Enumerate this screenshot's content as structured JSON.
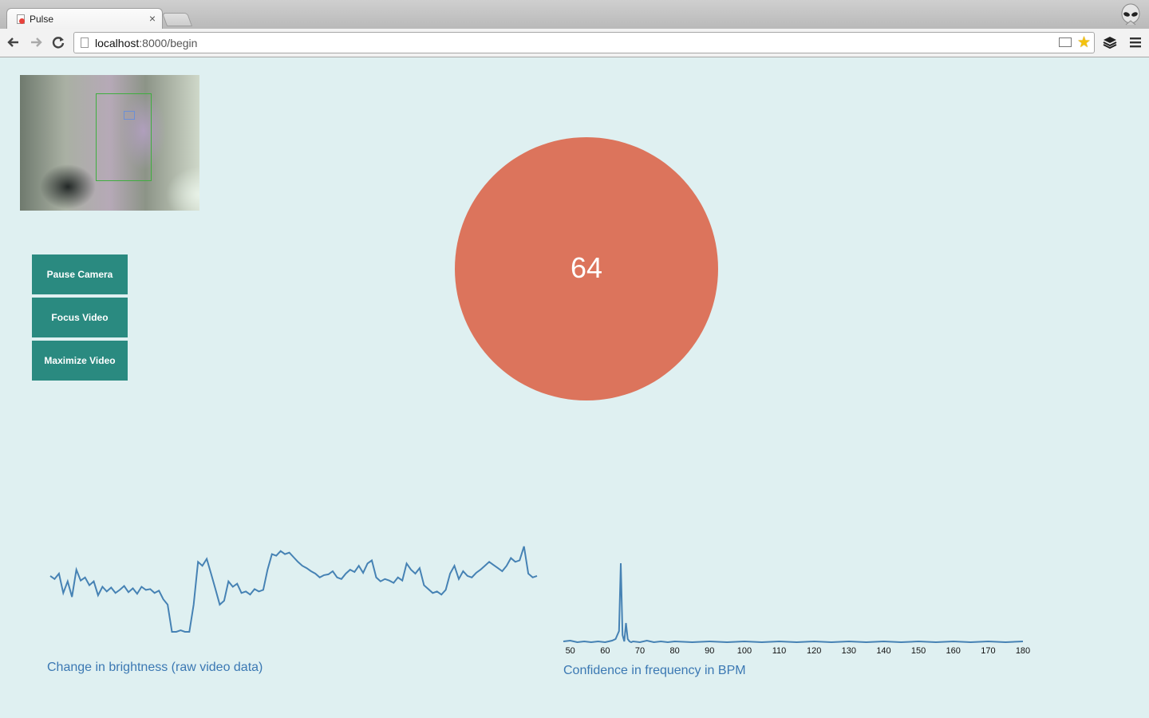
{
  "browser": {
    "tab_title": "Pulse",
    "tab_close": "×",
    "url_host": "localhost",
    "url_path": ":8000/begin",
    "back_icon": "back-arrow-icon",
    "forward_icon": "forward-arrow-icon",
    "reload_icon": "reload-icon",
    "star_icon": "bookmark-star-icon",
    "menu_icon": "menu-icon",
    "extension_icon": "layers-icon",
    "profile_icon": "alien-avatar-icon"
  },
  "controls": {
    "pause_camera": "Pause Camera",
    "focus_video": "Focus Video",
    "maximize_video": "Maximize Video"
  },
  "colors": {
    "page_bg": "#dff0f1",
    "button_bg": "#2a8a80",
    "bpm_circle": "#dc745c",
    "line": "#4682b4"
  },
  "bpm": {
    "value": "64"
  },
  "raw_chart": {
    "caption": "Change in brightness (raw video data)"
  },
  "fft_chart": {
    "caption": "Confidence in frequency in BPM"
  },
  "chart_data": [
    {
      "type": "line",
      "title": "Change in brightness (raw video data)",
      "x": [
        0,
        1,
        2,
        3,
        4,
        5,
        6,
        7,
        8,
        9,
        10,
        11,
        12,
        13,
        14,
        15,
        16,
        17,
        18,
        19,
        20,
        21,
        22,
        23,
        24,
        25,
        26,
        27,
        28,
        29,
        30,
        31,
        32,
        33,
        34,
        35,
        36,
        37,
        38,
        39,
        40,
        41,
        42,
        43,
        44,
        45,
        46,
        47,
        48,
        49,
        50,
        51,
        52,
        53,
        54,
        55,
        56,
        57,
        58,
        59,
        60,
        61,
        62,
        63,
        64,
        65,
        66,
        67,
        68,
        69,
        70,
        71,
        72,
        73,
        74,
        75,
        76,
        77,
        78,
        79,
        80,
        81,
        82,
        83,
        84,
        85,
        86,
        87,
        88,
        89,
        90,
        91,
        92,
        93,
        94,
        95,
        96,
        97,
        98,
        99,
        100,
        101,
        102,
        103,
        104,
        105,
        106,
        107,
        108,
        109,
        110,
        111,
        112,
        113,
        114,
        115,
        116,
        117,
        118,
        119
      ],
      "values": [
        0.42,
        0.38,
        0.45,
        0.2,
        0.35,
        0.15,
        0.5,
        0.36,
        0.4,
        0.3,
        0.35,
        0.17,
        0.28,
        0.22,
        0.27,
        0.2,
        0.24,
        0.29,
        0.21,
        0.26,
        0.19,
        0.28,
        0.24,
        0.25,
        0.2,
        0.23,
        0.12,
        0.05,
        -0.3,
        -0.4,
        -0.28,
        -0.32,
        -0.4,
        0.05,
        0.6,
        0.55,
        0.64,
        0.45,
        0.25,
        0.05,
        0.1,
        0.35,
        0.28,
        0.32,
        0.2,
        0.22,
        0.18,
        0.25,
        0.22,
        0.24,
        0.5,
        0.7,
        0.68,
        0.74,
        0.7,
        0.72,
        0.66,
        0.6,
        0.55,
        0.52,
        0.48,
        0.45,
        0.4,
        0.43,
        0.44,
        0.48,
        0.4,
        0.38,
        0.45,
        0.5,
        0.47,
        0.55,
        0.46,
        0.58,
        0.62,
        0.4,
        0.35,
        0.38,
        0.36,
        0.33,
        0.4,
        0.36,
        0.58,
        0.5,
        0.45,
        0.52,
        0.3,
        0.25,
        0.2,
        0.22,
        0.18,
        0.24,
        0.45,
        0.55,
        0.38,
        0.48,
        0.42,
        0.4,
        0.46,
        0.5,
        0.55,
        0.6,
        0.56,
        0.52,
        0.48,
        0.55,
        0.65,
        0.6,
        0.62,
        0.8,
        0.45,
        0.4,
        0.42
      ],
      "xlabel": "",
      "ylabel": ""
    },
    {
      "type": "line",
      "title": "Confidence in frequency in BPM",
      "xlabel": "",
      "ylabel": "",
      "xlim": [
        48,
        180
      ],
      "xticks": [
        "50",
        "60",
        "70",
        "80",
        "90",
        "100",
        "110",
        "120",
        "130",
        "140",
        "150",
        "160",
        "170",
        "180"
      ],
      "x": [
        48,
        50,
        52,
        54,
        56,
        58,
        60,
        62,
        63,
        64,
        64.5,
        65,
        65.5,
        66,
        66.5,
        67,
        67.5,
        68,
        70,
        72,
        74,
        76,
        78,
        80,
        85,
        90,
        95,
        100,
        105,
        110,
        115,
        120,
        125,
        130,
        135,
        140,
        145,
        150,
        155,
        160,
        165,
        170,
        175,
        180
      ],
      "values": [
        0.02,
        0.03,
        0.01,
        0.02,
        0.01,
        0.02,
        0.01,
        0.03,
        0.05,
        0.15,
        1.0,
        0.1,
        0.02,
        0.25,
        0.05,
        0.02,
        0.01,
        0.02,
        0.01,
        0.03,
        0.01,
        0.02,
        0.01,
        0.02,
        0.01,
        0.02,
        0.01,
        0.02,
        0.01,
        0.02,
        0.01,
        0.02,
        0.01,
        0.02,
        0.01,
        0.02,
        0.01,
        0.02,
        0.01,
        0.02,
        0.01,
        0.02,
        0.01,
        0.02
      ],
      "ylim": [
        0,
        1
      ]
    }
  ]
}
